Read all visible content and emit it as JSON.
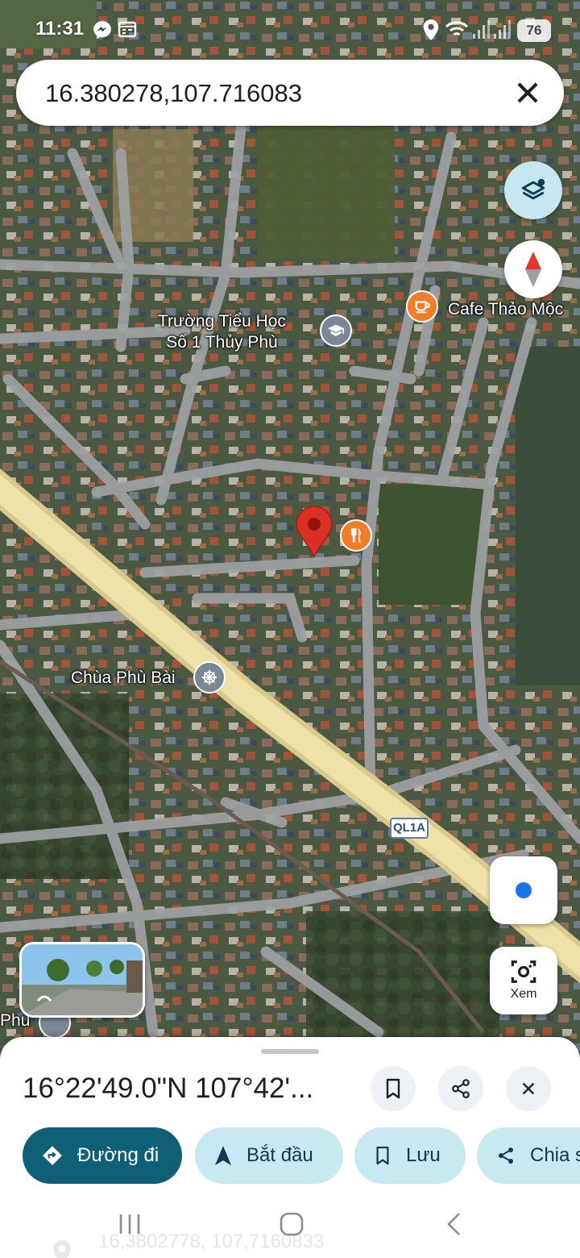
{
  "status_bar": {
    "time": "11:31",
    "battery": "76",
    "icons": [
      "messenger-icon",
      "calendar-icon",
      "location-icon",
      "wifi-icon",
      "signal-icon",
      "signal-icon"
    ]
  },
  "search": {
    "query": "16.380278,107.716083",
    "clear_icon": "close-icon"
  },
  "map": {
    "labels": {
      "school": "Trường Tiểu Học\nSố 1 Thủy Phù",
      "cafe": "Cafe Thảo Mộc",
      "pagoda": "Chùa Phù Bài",
      "partial": "Phù",
      "highway_shield": "QL1A"
    },
    "poi_icons": {
      "school": "graduation-cap-icon",
      "cafe": "coffee-cup-icon",
      "restaurant": "fork-knife-icon",
      "pagoda": "dharma-wheel-icon"
    },
    "colors": {
      "pin": "#d93025",
      "poi_orange": "#f27c28",
      "poi_gray": "#7b8794"
    }
  },
  "controls": {
    "layers_icon": "layers-icon",
    "compass_icon": "compass-icon",
    "location_icon": "my-location-icon",
    "lens_label": "Xem"
  },
  "sheet": {
    "title": "16°22'49.0\"N 107°42'...",
    "buttons": [
      "bookmark-icon",
      "share-icon",
      "close-icon"
    ],
    "chips": {
      "directions": "Đường đi",
      "start": "Bắt đầu",
      "save": "Lưu",
      "share": "Chia s"
    },
    "ghost_coords": "16,3802778, 107,7160833",
    "colors": {
      "primary": "#0f5f76",
      "chip": "#c8e8f2"
    }
  }
}
